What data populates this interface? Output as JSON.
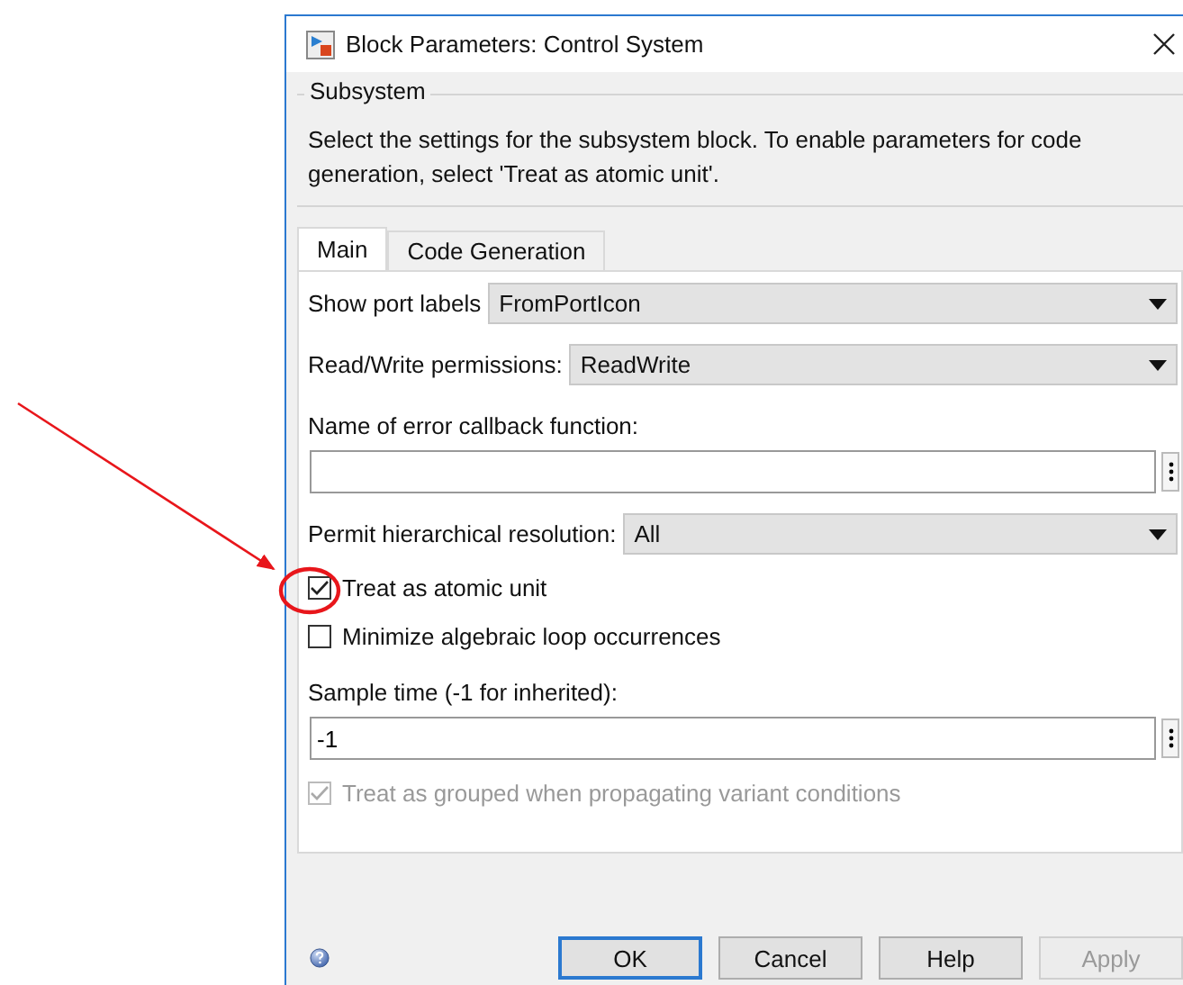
{
  "window": {
    "title": "Block Parameters: Control System"
  },
  "group": {
    "title": "Subsystem",
    "description": "Select the settings for the subsystem block. To enable parameters for code generation, select 'Treat as atomic unit'."
  },
  "tabs": [
    {
      "label": "Main",
      "selected": true
    },
    {
      "label": "Code Generation",
      "selected": false
    }
  ],
  "fields": [
    {
      "kind": "select",
      "label": "Show port labels",
      "value": "FromPortIcon"
    },
    {
      "kind": "select",
      "label": "Read/Write permissions:",
      "value": "ReadWrite"
    },
    {
      "kind": "text",
      "label": "Name of error callback function:"
    },
    {
      "kind": "select",
      "label": "Permit hierarchical resolution:",
      "value": "All"
    },
    {
      "kind": "checkbox",
      "label": "Treat as atomic unit",
      "checked": true,
      "disabled": false
    },
    {
      "kind": "checkbox",
      "label": "Minimize algebraic loop occurrences",
      "checked": false,
      "disabled": false
    },
    {
      "kind": "text",
      "label": "Sample time (-1 for inherited):",
      "value": "-1"
    },
    {
      "kind": "checkbox",
      "label": "Treat as grouped when propagating variant conditions",
      "checked": true,
      "disabled": true
    }
  ],
  "buttons": [
    {
      "label": "OK",
      "default": true,
      "disabled": false
    },
    {
      "label": "Cancel",
      "default": false,
      "disabled": false
    },
    {
      "label": "Help",
      "default": false,
      "disabled": false
    },
    {
      "label": "Apply",
      "default": false,
      "disabled": true
    }
  ]
}
